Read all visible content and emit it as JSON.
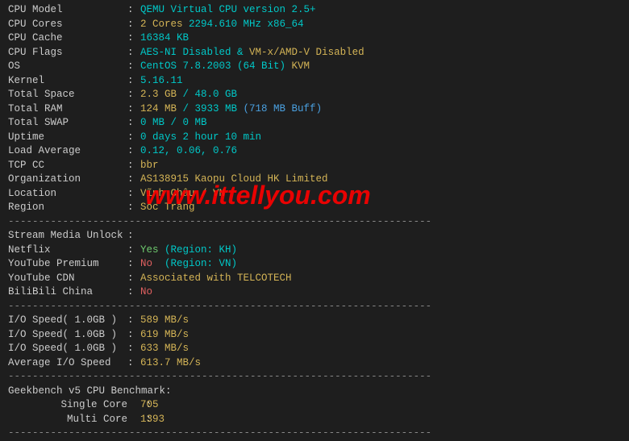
{
  "sysinfo": {
    "cpu_model": {
      "label": "CPU Model",
      "value": "QEMU Virtual CPU version 2.5+"
    },
    "cpu_cores": {
      "label": "CPU Cores",
      "count": "2 Cores",
      "freq": " 2294.610 MHz x86_64"
    },
    "cpu_cache": {
      "label": "CPU Cache",
      "value": "16384 KB"
    },
    "cpu_flags": {
      "label": "CPU Flags",
      "aes": "AES-NI Disabled",
      "amp": " & ",
      "vmx": "VM-x/AMD-V Disabled"
    },
    "os": {
      "label": "OS",
      "distro": "CentOS 7.8.2003 (64 Bit)",
      "virt": " KVM"
    },
    "kernel": {
      "label": "Kernel",
      "value": "5.16.11"
    },
    "total_space": {
      "label": "Total Space",
      "used": "2.3 GB",
      "sep": " / ",
      "total": "48.0 GB"
    },
    "total_ram": {
      "label": "Total RAM",
      "used": "124 MB",
      "sep": " / ",
      "total": "3933 MB",
      "buff": " (718 MB Buff)"
    },
    "total_swap": {
      "label": "Total SWAP",
      "used": "0 MB",
      "sep": " / ",
      "total": "0 MB"
    },
    "uptime": {
      "label": "Uptime",
      "value": "0 days 2 hour 10 min"
    },
    "load_avg": {
      "label": "Load Average",
      "value": "0.12, 0.06, 0.76"
    },
    "tcp_cc": {
      "label": "TCP CC",
      "value": "bbr"
    },
    "organization": {
      "label": "Organization",
      "value": "AS138915 Kaopu Cloud HK Limited"
    },
    "location": {
      "label": "Location",
      "value": "Vĩnh Châu / VN"
    },
    "region": {
      "label": "Region",
      "value": "Sóc Trăng"
    }
  },
  "stream": {
    "header": {
      "label": "Stream Media Unlock",
      "colon": ":"
    },
    "netflix": {
      "label": "Netflix",
      "status": "Yes",
      "region": " (Region: KH)"
    },
    "youtube_premium": {
      "label": "YouTube Premium",
      "status": "No ",
      "region": " (Region: VN)"
    },
    "youtube_cdn": {
      "label": "YouTube CDN",
      "value": "Associated with TELCOTECH"
    },
    "bilibili": {
      "label": "BiliBili China",
      "status": "No"
    }
  },
  "io": {
    "r1": {
      "label": "I/O Speed( 1.0GB )",
      "value": "589 MB/s"
    },
    "r2": {
      "label": "I/O Speed( 1.0GB )",
      "value": "619 MB/s"
    },
    "r3": {
      "label": "I/O Speed( 1.0GB )",
      "value": "633 MB/s"
    },
    "avg": {
      "label": "Average I/O Speed",
      "value": "613.7 MB/s"
    }
  },
  "geekbench": {
    "header": "Geekbench v5 CPU Benchmark:",
    "single": {
      "label": "Single Core",
      "value": "705"
    },
    "multi": {
      "label": "Multi Core",
      "value": "1393"
    }
  },
  "divider": "----------------------------------------------------------------------",
  "watermark": "www.ittellyou.com"
}
